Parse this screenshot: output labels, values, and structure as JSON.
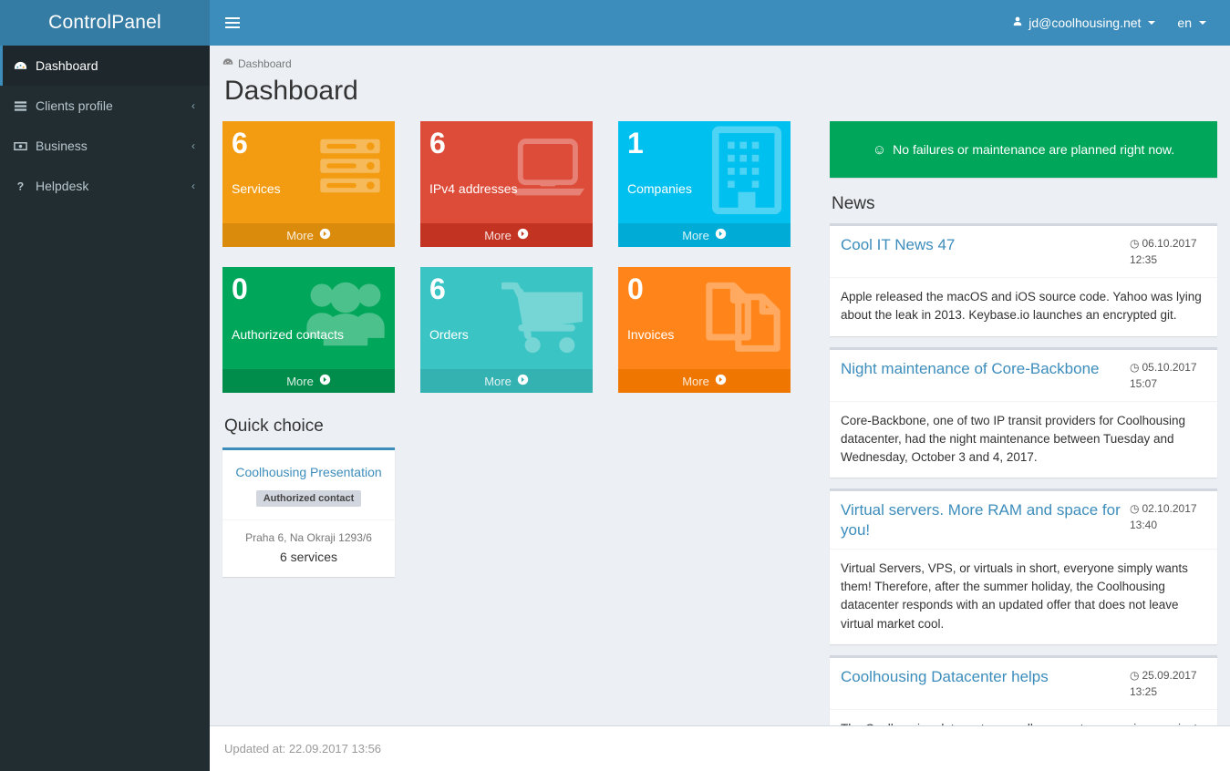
{
  "brand": {
    "title": "ControlPanel"
  },
  "topbar": {
    "menu_icon": "hamburger-icon",
    "user": "jd@coolhousing.net",
    "language": "en"
  },
  "sidebar": {
    "items": [
      {
        "label": "Dashboard",
        "icon": "tachometer-icon",
        "active": true,
        "arrow": ""
      },
      {
        "label": "Clients profile",
        "icon": "server-list-icon",
        "active": false,
        "arrow": "‹"
      },
      {
        "label": "Business",
        "icon": "money-bill-icon",
        "active": false,
        "arrow": "‹"
      },
      {
        "label": "Helpdesk",
        "icon": "question-mark-icon",
        "active": false,
        "arrow": "‹"
      }
    ]
  },
  "breadcrumb": {
    "icon": "tachometer-icon",
    "label": "Dashboard"
  },
  "page": {
    "title": "Dashboard"
  },
  "tiles": [
    {
      "value": "6",
      "label": "Services",
      "more": "More",
      "icon": "server-icon",
      "color": "#f39c12",
      "footer_color": "#db8b0b"
    },
    {
      "value": "6",
      "label": "IPv4 addresses",
      "more": "More",
      "icon": "laptop-icon",
      "color": "#dd4b39",
      "footer_color": "#c23321"
    },
    {
      "value": "1",
      "label": "Companies",
      "more": "More",
      "icon": "building-icon",
      "color": "#00c0ef",
      "footer_color": "#00acd6"
    },
    {
      "value": "0",
      "label": "Authorized contacts",
      "more": "More",
      "icon": "users-icon",
      "color": "#00a65a",
      "footer_color": "#008d4c"
    },
    {
      "value": "6",
      "label": "Orders",
      "more": "More",
      "icon": "cart-icon",
      "color": "#3bc4c4",
      "footer_color": "#34b1b1"
    },
    {
      "value": "0",
      "label": "Invoices",
      "more": "More",
      "icon": "files-icon",
      "color": "#ff851b",
      "footer_color": "#ef7600"
    }
  ],
  "quick_choice": {
    "title": "Quick choice",
    "card": {
      "name": "Coolhousing Presentation",
      "badge": "Authorized contact",
      "address": "Praha 6, Na Okraji 1293/6",
      "services": "6 services"
    }
  },
  "alert": {
    "icon": "smiley-icon",
    "text": "No failures or maintenance are planned right now.",
    "color": "#00a65a"
  },
  "news": {
    "title": "News",
    "items": [
      {
        "title": "Cool IT News 47",
        "date": "06.10.2017",
        "time": "12:35",
        "text": "Apple released the macOS and iOS source code. Yahoo was lying about the leak in 2013. Keybase.io launches an encrypted git."
      },
      {
        "title": "Night maintenance of Core-Backbone",
        "date": "05.10.2017",
        "time": "15:07",
        "text": "Core-Backbone, one of two IP transit providers for Coolhousing datacenter, had the night maintenance between Tuesday and Wednesday, October 3 and 4, 2017."
      },
      {
        "title": "Virtual servers. More RAM and space for you!",
        "date": "02.10.2017",
        "time": "13:40",
        "text": "Virtual Servers, VPS, or virtuals in short, everyone simply wants them! Therefore, after the summer holiday, the Coolhousing datacenter responds with an updated offer that does not leave virtual market cool."
      },
      {
        "title": "Coolhousing Datacenter helps",
        "date": "25.09.2017",
        "time": "13:25",
        "text": "The Coolhousing datacenter proudly supports very unique project"
      }
    ]
  },
  "footer": {
    "updated": "Updated at: 22.09.2017 13:56"
  }
}
